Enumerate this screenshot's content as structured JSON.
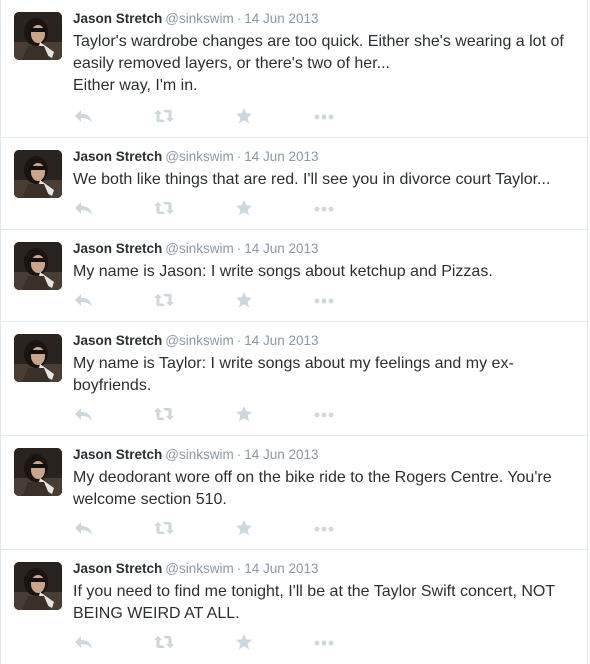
{
  "tweets": [
    {
      "fullname": "Jason Stretch",
      "username": "@sinkswim",
      "separator": "·",
      "time": "14 Jun 2013",
      "lines": [
        "Taylor's wardrobe changes are too quick. Either she's wearing a lot of",
        "easily removed layers, or there's two of her...",
        "Either way, I'm in."
      ]
    },
    {
      "fullname": "Jason Stretch",
      "username": "@sinkswim",
      "separator": "·",
      "time": "14 Jun 2013",
      "lines": [
        "We both like things that are red. I'll see you in divorce court Taylor..."
      ]
    },
    {
      "fullname": "Jason Stretch",
      "username": "@sinkswim",
      "separator": "·",
      "time": "14 Jun 2013",
      "lines": [
        "My name is Jason: I write songs about ketchup and Pizzas."
      ]
    },
    {
      "fullname": "Jason Stretch",
      "username": "@sinkswim",
      "separator": "·",
      "time": "14 Jun 2013",
      "lines": [
        "My name is Taylor: I write songs about my feelings and my ex-",
        "boyfriends."
      ]
    },
    {
      "fullname": "Jason Stretch",
      "username": "@sinkswim",
      "separator": "·",
      "time": "14 Jun 2013",
      "lines": [
        "My deodorant wore off on the bike ride to the Rogers Centre. You're",
        "welcome section 510."
      ]
    },
    {
      "fullname": "Jason Stretch",
      "username": "@sinkswim",
      "separator": "·",
      "time": "14 Jun 2013",
      "lines": [
        "If you need to find me tonight, I'll be at the Taylor Swift concert, NOT",
        "BEING WEIRD AT ALL."
      ]
    }
  ],
  "icons": {
    "reply": "reply-icon",
    "retweet": "retweet-icon",
    "favorite": "star-icon",
    "more": "more-icon"
  },
  "colors": {
    "text": "#292f33",
    "meta": "#8899a6",
    "action_icon": "#ccd6dd",
    "divider": "#e1e8ed"
  }
}
